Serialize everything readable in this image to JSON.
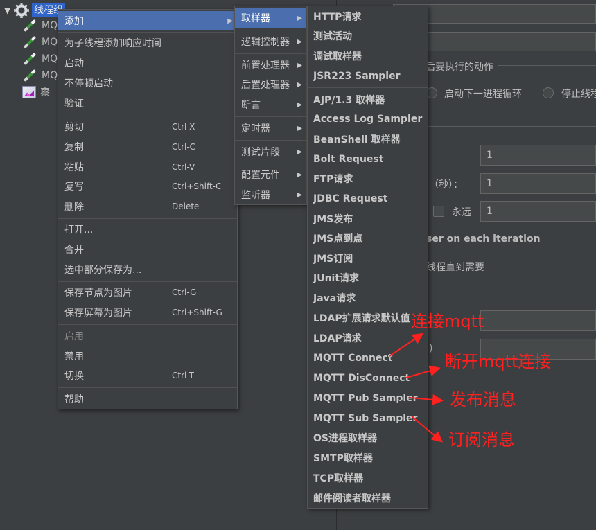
{
  "tree": {
    "root_label": "线程组",
    "items": [
      {
        "label": "MQ",
        "icon": "pipette-icon"
      },
      {
        "label": "MQ",
        "icon": "pipette-icon"
      },
      {
        "label": "MQ",
        "icon": "pipette-icon"
      },
      {
        "label": "MQ",
        "icon": "pipette-icon"
      },
      {
        "label": "察",
        "icon": "listener-icon"
      }
    ]
  },
  "right_panel": {
    "action_title": "后要执行的动作",
    "radio_next_loop": "启动下一进程循环",
    "radio_stop": "停止线程",
    "threads_value": "1",
    "rampup_label": "间（秒）：",
    "rampup_value": "1",
    "forever_label": "永远",
    "loop_value": "1",
    "same_user_label": "ser on each iteration",
    "delay_label": "线程直到需要",
    "paren": ")"
  },
  "main_menu": {
    "items": [
      {
        "label": "添加",
        "shortcut": "",
        "submenu": true,
        "highlight": true
      },
      {
        "label": "为子线程添加响应时间",
        "shortcut": ""
      },
      {
        "label": "启动",
        "shortcut": ""
      },
      {
        "label": "不停顿启动",
        "shortcut": ""
      },
      {
        "label": "验证",
        "shortcut": ""
      },
      {
        "label": "剪切",
        "shortcut": "Ctrl-X"
      },
      {
        "label": "复制",
        "shortcut": "Ctrl-C"
      },
      {
        "label": "粘贴",
        "shortcut": "Ctrl-V"
      },
      {
        "label": "复写",
        "shortcut": "Ctrl+Shift-C"
      },
      {
        "label": "删除",
        "shortcut": "Delete"
      },
      {
        "label": "打开...",
        "shortcut": ""
      },
      {
        "label": "合并",
        "shortcut": ""
      },
      {
        "label": "选中部分保存为...",
        "shortcut": ""
      },
      {
        "label": "保存节点为图片",
        "shortcut": "Ctrl-G"
      },
      {
        "label": "保存屏幕为图片",
        "shortcut": "Ctrl+Shift-G"
      },
      {
        "label": "启用",
        "shortcut": "",
        "disabled": true
      },
      {
        "label": "禁用",
        "shortcut": ""
      },
      {
        "label": "切换",
        "shortcut": "Ctrl-T"
      },
      {
        "label": "帮助",
        "shortcut": ""
      }
    ]
  },
  "add_menu": {
    "items": [
      {
        "label": "取样器",
        "highlight": true
      },
      {
        "label": "逻辑控制器"
      },
      {
        "label": "前置处理器"
      },
      {
        "label": "后置处理器"
      },
      {
        "label": "断言"
      },
      {
        "label": "定时器"
      },
      {
        "label": "测试片段"
      },
      {
        "label": "配置元件"
      },
      {
        "label": "监听器"
      }
    ]
  },
  "sampler_menu": {
    "items": [
      "HTTP请求",
      "测试活动",
      "调试取样器",
      "JSR223 Sampler",
      "AJP/1.3 取样器",
      "Access Log Sampler",
      "BeanShell 取样器",
      "Bolt Request",
      "FTP请求",
      "JDBC Request",
      "JMS发布",
      "JMS点到点",
      "JMS订阅",
      "JUnit请求",
      "Java请求",
      "LDAP扩展请求默认值",
      "LDAP请求",
      "MQTT Connect",
      "MQTT DisConnect",
      "MQTT Pub Sampler",
      "MQTT Sub Sampler",
      "OS进程取样器",
      "SMTP取样器",
      "TCP取样器",
      "邮件阅读者取样器"
    ]
  },
  "annotations": {
    "connect": "连接mqtt",
    "disconnect": "断开mqtt连接",
    "publish": "发布消息",
    "subscribe": "订阅消息",
    "color": "#ff2020"
  },
  "colors": {
    "background": "#3c3f41",
    "highlight": "#4b6eaf",
    "selection": "#2f65ca",
    "text": "#bbbbbb"
  }
}
